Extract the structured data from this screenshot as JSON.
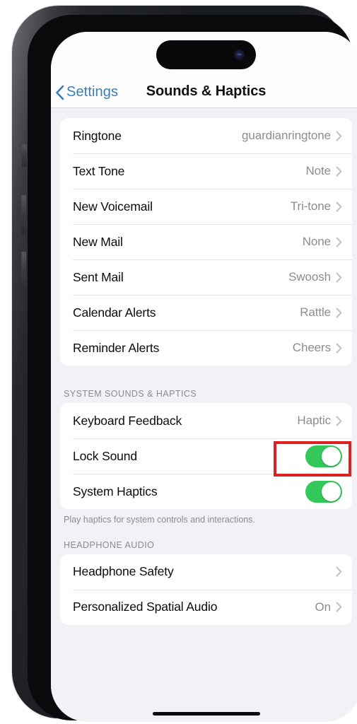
{
  "device": {
    "name": "iPhone",
    "dynamic_island": "dynamic-island",
    "home_indicator": "home-indicator"
  },
  "nav": {
    "back_label": "Settings",
    "title": "Sounds & Haptics"
  },
  "sections": [
    {
      "header": "",
      "footer": "",
      "rows": [
        {
          "label": "Ringtone",
          "value": "guardianringtone",
          "type": "disclosure"
        },
        {
          "label": "Text Tone",
          "value": "Note",
          "type": "disclosure"
        },
        {
          "label": "New Voicemail",
          "value": "Tri-tone",
          "type": "disclosure"
        },
        {
          "label": "New Mail",
          "value": "None",
          "type": "disclosure"
        },
        {
          "label": "Sent Mail",
          "value": "Swoosh",
          "type": "disclosure"
        },
        {
          "label": "Calendar Alerts",
          "value": "Rattle",
          "type": "disclosure"
        },
        {
          "label": "Reminder Alerts",
          "value": "Cheers",
          "type": "disclosure"
        }
      ]
    },
    {
      "header": "SYSTEM SOUNDS & HAPTICS",
      "footer": "Play haptics for system controls and interactions.",
      "rows": [
        {
          "label": "Keyboard Feedback",
          "value": "Haptic",
          "type": "disclosure"
        },
        {
          "label": "Lock Sound",
          "value": "On",
          "type": "toggle"
        },
        {
          "label": "System Haptics",
          "value": "On",
          "type": "toggle"
        }
      ]
    },
    {
      "header": "HEADPHONE AUDIO",
      "footer": "",
      "rows": [
        {
          "label": "Headphone Safety",
          "value": "",
          "type": "disclosure"
        },
        {
          "label": "Personalized Spatial Audio",
          "value": "On",
          "type": "disclosure"
        }
      ]
    }
  ],
  "annotation": {
    "target": "Keyboard Feedback value",
    "color": "#e02020"
  },
  "colors": {
    "accent_blue": "#3b7fb5",
    "toggle_on_green": "#34c759",
    "page_background": "#f1f1f6",
    "card_background": "#ffffff",
    "secondary_text": "#8a8a90",
    "annotation_red": "#e02020"
  }
}
